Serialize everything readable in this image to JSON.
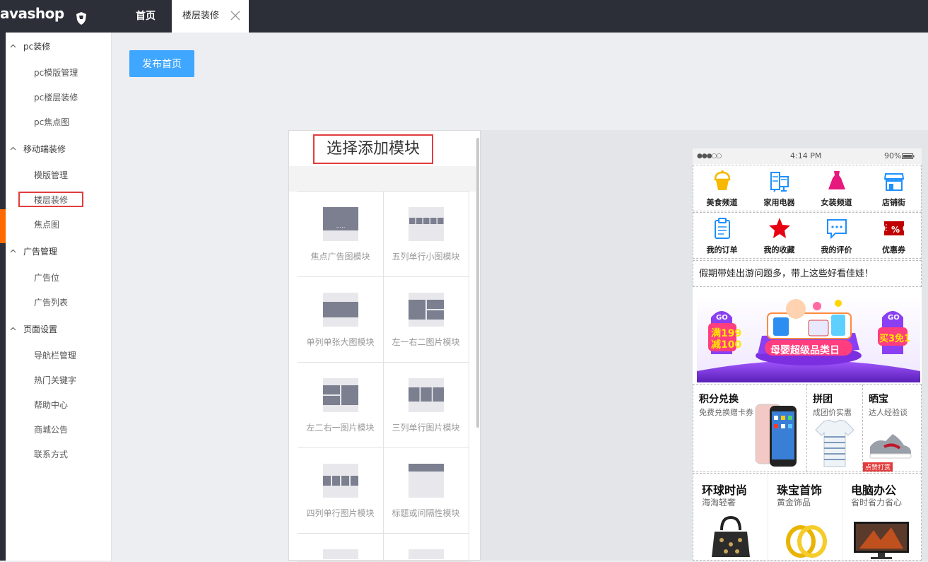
{
  "app": {
    "brand": "avashop"
  },
  "tabs": [
    {
      "label": "首页"
    },
    {
      "label": "楼层装修"
    }
  ],
  "sidebar": {
    "groups": [
      {
        "label": "pc装修",
        "items": [
          {
            "label": "pc模版管理"
          },
          {
            "label": "pc楼层装修"
          },
          {
            "label": "pc焦点图"
          }
        ]
      },
      {
        "label": "移动端装修",
        "items": [
          {
            "label": "模版管理"
          },
          {
            "label": "楼层装修"
          },
          {
            "label": "焦点图"
          }
        ]
      },
      {
        "label": "广告管理",
        "items": [
          {
            "label": "广告位"
          },
          {
            "label": "广告列表"
          }
        ]
      },
      {
        "label": "页面设置",
        "items": [
          {
            "label": "导航栏管理"
          },
          {
            "label": "热门关键字"
          },
          {
            "label": "帮助中心"
          },
          {
            "label": "商城公告"
          },
          {
            "label": "联系方式"
          }
        ]
      }
    ]
  },
  "toolbar": {
    "publish_label": "发布首页"
  },
  "panel": {
    "title": "选择添加模块",
    "modules": [
      {
        "label": "焦点广告图模块",
        "icon": "focus-ad-module-icon"
      },
      {
        "label": "五列单行小图模块",
        "icon": "five-column-module-icon"
      },
      {
        "label": "单列单张大图模块",
        "icon": "single-large-image-module-icon"
      },
      {
        "label": "左一右二图片模块",
        "icon": "left1-right2-module-icon"
      },
      {
        "label": "左二右一图片模块",
        "icon": "left2-right1-module-icon"
      },
      {
        "label": "三列单行图片模块",
        "icon": "three-column-module-icon"
      },
      {
        "label": "四列单行图片模块",
        "icon": "four-column-module-icon"
      },
      {
        "label": "标题或间隔性模块",
        "icon": "title-spacer-module-icon"
      }
    ]
  },
  "phone": {
    "status": {
      "signal": "●●●○○",
      "time": "4:14 PM",
      "battery": "90%"
    },
    "nav_row1": [
      {
        "label": "美食频道",
        "icon": "cupcake-icon",
        "color": "#f6b800"
      },
      {
        "label": "家用电器",
        "icon": "appliance-icon",
        "color": "#1e90ff"
      },
      {
        "label": "女装频道",
        "icon": "dress-icon",
        "color": "#e6197d"
      },
      {
        "label": "店铺街",
        "icon": "storefront-icon",
        "color": "#1e90ff"
      }
    ],
    "nav_row2": [
      {
        "label": "我的订单",
        "icon": "clipboard-icon",
        "color": "#1e90ff"
      },
      {
        "label": "我的收藏",
        "icon": "star-icon",
        "color": "#e60012"
      },
      {
        "label": "我的评价",
        "icon": "comment-icon",
        "color": "#1e90ff"
      },
      {
        "label": "优惠券",
        "icon": "coupon-icon",
        "color": "#c00000"
      }
    ],
    "notice": "假期带娃出游问题多，带上这些好看佳娃！",
    "banner": {
      "left_go": "GO",
      "left_line1": "满199",
      "left_line2": "减100",
      "headline": "母婴超级品类日",
      "right_go": "GO",
      "right_text": "买3免1"
    },
    "promo": {
      "a_title": "积分兑换",
      "a_sub": "免费兑换赠卡券",
      "b_title": "拼团",
      "b_sub": "成团价实惠",
      "c_title": "晒宝",
      "c_sub": "达人经验谈",
      "c_badge": "点赞打赏"
    },
    "floor": [
      {
        "title": "环球时尚",
        "sub": "海淘轻奢"
      },
      {
        "title": "珠宝首饰",
        "sub": "黄金饰品"
      },
      {
        "title": "电脑办公",
        "sub": "省时省力省心"
      }
    ]
  }
}
